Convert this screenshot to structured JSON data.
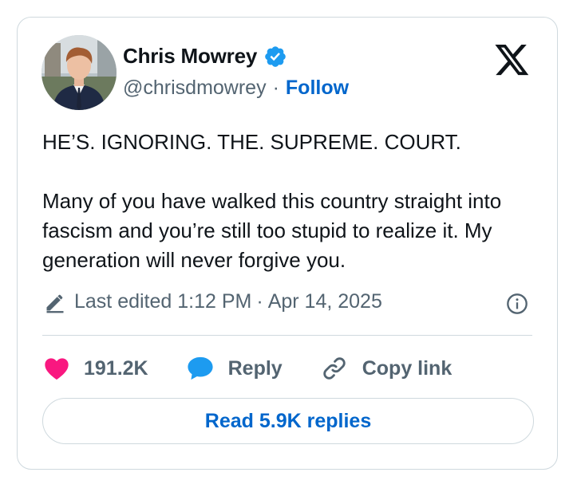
{
  "author": {
    "name": "Chris Mowrey",
    "handle": "@chrisdmowrey",
    "separator": "·",
    "follow_label": "Follow",
    "verified_icon": "verified-badge-icon",
    "verified_color": "#1d9bf0"
  },
  "brand_icon": "x-logo-icon",
  "tweet": {
    "paragraphs": [
      "HE’S. IGNORING. THE. SUPREME. COURT.",
      "Many of you have walked this country straight into fascism and you’re still too stupid to realize it. My generation will never forgive you."
    ]
  },
  "meta": {
    "edited_label": "Last edited 1:12 PM",
    "separator": "·",
    "date": "Apr 14, 2025",
    "edit_icon": "pencil-icon",
    "info_icon": "info-icon"
  },
  "actions": {
    "likes": "191.2K",
    "like_icon": "heart-icon",
    "like_color": "#f91880",
    "reply_label": "Reply",
    "reply_icon": "speech-bubble-icon",
    "reply_color": "#1d9bf0",
    "copy_label": "Copy link",
    "copy_icon": "link-icon"
  },
  "read_replies_label": "Read 5.9K replies",
  "colors": {
    "text": "#0f1419",
    "secondary": "#536471",
    "link": "#0066cc",
    "border": "#cfd9de"
  }
}
